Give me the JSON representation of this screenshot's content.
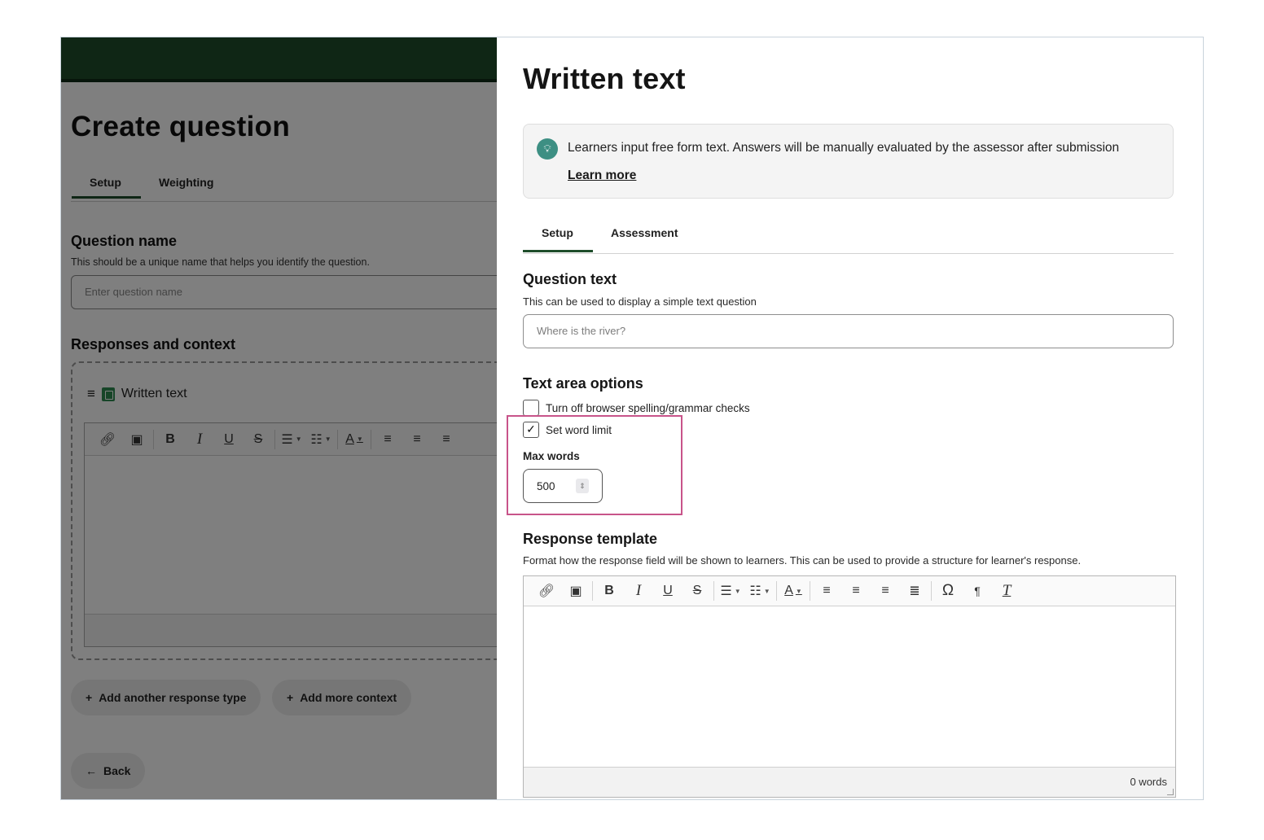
{
  "left": {
    "page_title": "Create question",
    "tabs": [
      {
        "label": "Setup"
      },
      {
        "label": "Weighting"
      }
    ],
    "question_name": {
      "label": "Question name",
      "help": "This should be a unique name that helps you identify the question.",
      "placeholder": "Enter question name"
    },
    "responses_label": "Responses and context",
    "response_item": {
      "title": "Written text"
    },
    "add_response_button": "Add another response type",
    "add_context_button": "Add more context",
    "back_button": "Back"
  },
  "panel": {
    "title": "Written text",
    "info": {
      "text": "Learners input free form text. Answers will be manually evaluated by the assessor after submission",
      "link": "Learn more"
    },
    "tabs": [
      {
        "label": "Setup"
      },
      {
        "label": "Assessment"
      }
    ],
    "question_text": {
      "label": "Question text",
      "help": "This can be used to display a simple text question",
      "placeholder": "Where is the river?"
    },
    "text_area_options": {
      "label": "Text area options",
      "spelling_checkbox": {
        "label": "Turn off browser spelling/grammar checks",
        "checked": false
      },
      "word_limit_checkbox": {
        "label": "Set word limit",
        "checked": true
      },
      "max_words_label": "Max words",
      "max_words_value": "500"
    },
    "response_template": {
      "label": "Response template",
      "help": "Format how the response field will be shown to learners. This can be used to provide a structure for learner's response.",
      "word_count": "0 words"
    }
  },
  "toolbar_icons": [
    "link-icon",
    "image-icon",
    "bold-icon",
    "italic-icon",
    "underline-icon",
    "strikethrough-icon",
    "bullet-list-icon",
    "numbered-list-icon",
    "text-color-icon",
    "align-left-icon",
    "align-center-icon",
    "align-right-icon",
    "justify-icon",
    "special-char-icon",
    "text-direction-icon",
    "clear-format-icon"
  ],
  "colors": {
    "brand_green": "#1e4d2b",
    "highlight": "#c8548a",
    "info_icon": "#3d8f83"
  }
}
